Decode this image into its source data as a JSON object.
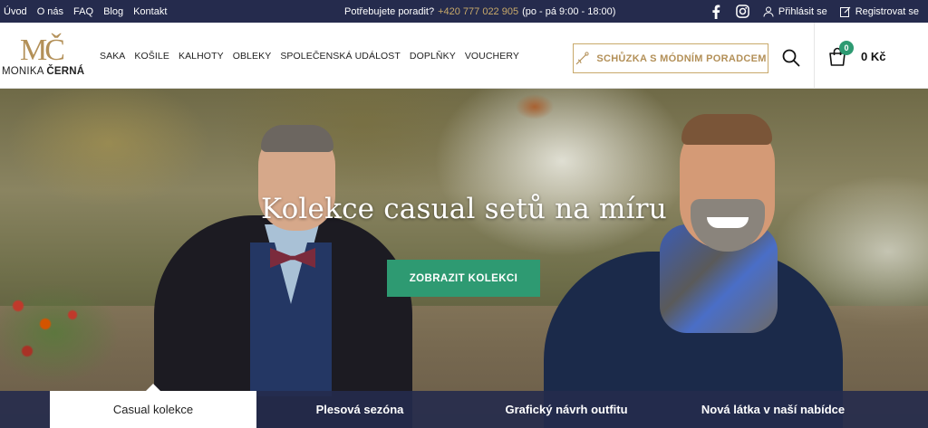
{
  "topbar": {
    "links": [
      "Úvod",
      "O nás",
      "FAQ",
      "Blog",
      "Kontakt"
    ],
    "help_text": "Potřebujete poradit?",
    "phone": "+420 777 022 905",
    "hours": "(po - pá 9:00 - 18:00)",
    "social": [
      "facebook-icon",
      "instagram-icon"
    ],
    "login_label": "Přihlásit se",
    "register_label": "Registrovat se"
  },
  "logo": {
    "monogram": "MČ",
    "first_name": "MONIKA ",
    "last_name": "ČERNÁ"
  },
  "nav": [
    "SAKA",
    "KOŠILE",
    "KALHOTY",
    "OBLEKY",
    "SPOLEČENSKÁ UDÁLOST",
    "DOPLŇKY",
    "VOUCHERY"
  ],
  "cta_label": "SCHŮZKA S MÓDNÍM PORADCEM",
  "cart": {
    "count": "0",
    "total": "0 Kč"
  },
  "hero": {
    "title": "Kolekce casual setů na míru",
    "button_label": "ZOBRAZIT KOLEKCI"
  },
  "tabs": [
    {
      "label": "Casual kolekce",
      "active": true
    },
    {
      "label": "Plesová sezóna",
      "active": false
    },
    {
      "label": "Grafický návrh outfitu",
      "active": false
    },
    {
      "label": "Nová látka v naší nabídce",
      "active": false
    }
  ],
  "colors": {
    "navy": "#252b4d",
    "gold": "#c8a96a",
    "green": "#2e9a72"
  }
}
